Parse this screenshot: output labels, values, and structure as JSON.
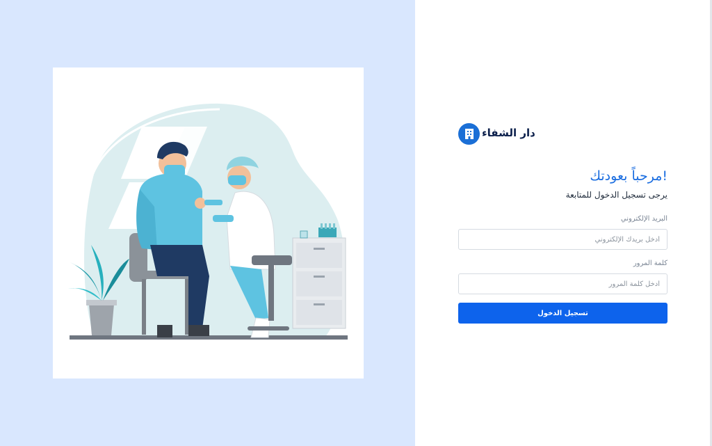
{
  "brand": {
    "name": "دار الشفاء",
    "logo_icon": "hospital-icon"
  },
  "welcome": {
    "title": "!مرحباً بعودتك",
    "subtitle": "يرجى تسجيل الدخول للمتابعة"
  },
  "form": {
    "email_label": "البريد الإلكتروني",
    "email_placeholder": "أدخل بريدك الإلكتروني",
    "password_label": "كلمة المرور",
    "password_placeholder": "أدخل كلمة المرور",
    "submit_label": "تسجيل الدخول"
  },
  "colors": {
    "left_background": "#d9e7fe",
    "accent": "#0d63ec",
    "title": "#1a6de0"
  }
}
